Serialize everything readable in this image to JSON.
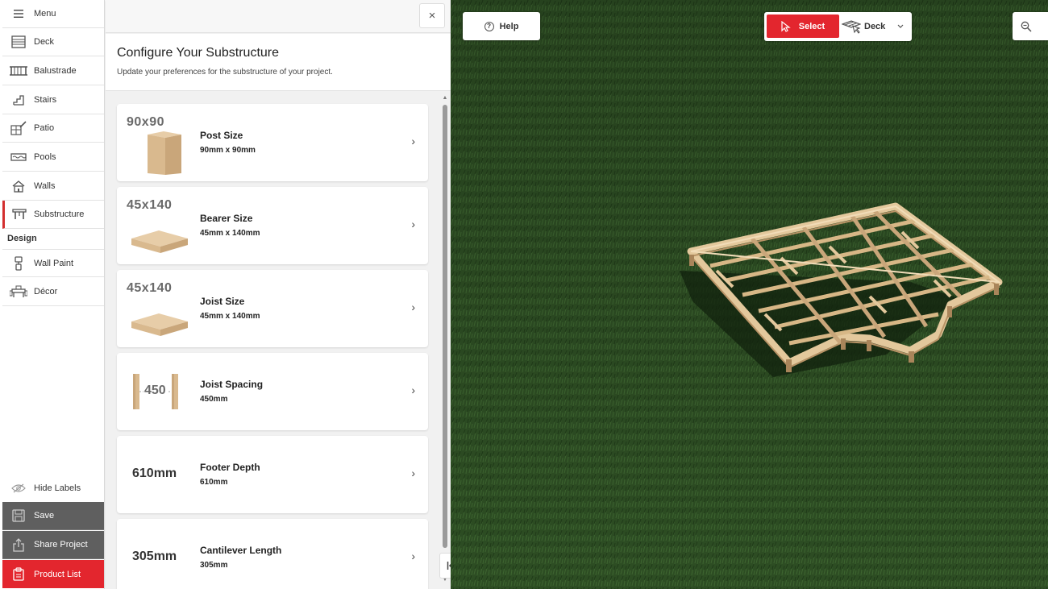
{
  "sidebar": {
    "menu_label": "Menu",
    "items": [
      {
        "label": "Deck",
        "icon": "deck-icon"
      },
      {
        "label": "Balustrade",
        "icon": "balustrade-icon"
      },
      {
        "label": "Stairs",
        "icon": "stairs-icon"
      },
      {
        "label": "Patio",
        "icon": "patio-icon"
      },
      {
        "label": "Pools",
        "icon": "pools-icon"
      },
      {
        "label": "Walls",
        "icon": "walls-icon"
      },
      {
        "label": "Substructure",
        "icon": "substructure-icon",
        "active": true
      }
    ],
    "design_heading": "Design",
    "design_items": [
      {
        "label": "Wall Paint",
        "icon": "wall-paint-icon"
      },
      {
        "label": "Décor",
        "icon": "decor-icon"
      }
    ],
    "hide_labels": "Hide Labels",
    "save": "Save",
    "share": "Share Project",
    "product_list": "Product List"
  },
  "panel": {
    "close_symbol": "×",
    "title": "Configure Your Substructure",
    "subtitle": "Update your preferences for the substructure of your project.",
    "options": [
      {
        "thumb_text": "90x90",
        "title": "Post Size",
        "value": "90mm x 90mm"
      },
      {
        "thumb_text": "45x140",
        "title": "Bearer Size",
        "value": "45mm x 140mm"
      },
      {
        "thumb_text": "45x140",
        "title": "Joist Size",
        "value": "45mm x 140mm"
      },
      {
        "thumb_text": "450",
        "title": "Joist Spacing",
        "value": "450mm"
      },
      {
        "thumb_text": "610mm",
        "title": "Footer Depth",
        "value": "610mm"
      },
      {
        "thumb_text": "305mm",
        "title": "Cantilever Length",
        "value": "305mm"
      }
    ],
    "chevron": "›"
  },
  "scene": {
    "help_label": "Help",
    "select_label": "Select",
    "deck_label": "Deck"
  },
  "colors": {
    "accent_red": "#e3262e",
    "dark_gray": "#5f5f5f",
    "grass": "#2c4c22",
    "timber": "#d9b98e"
  }
}
